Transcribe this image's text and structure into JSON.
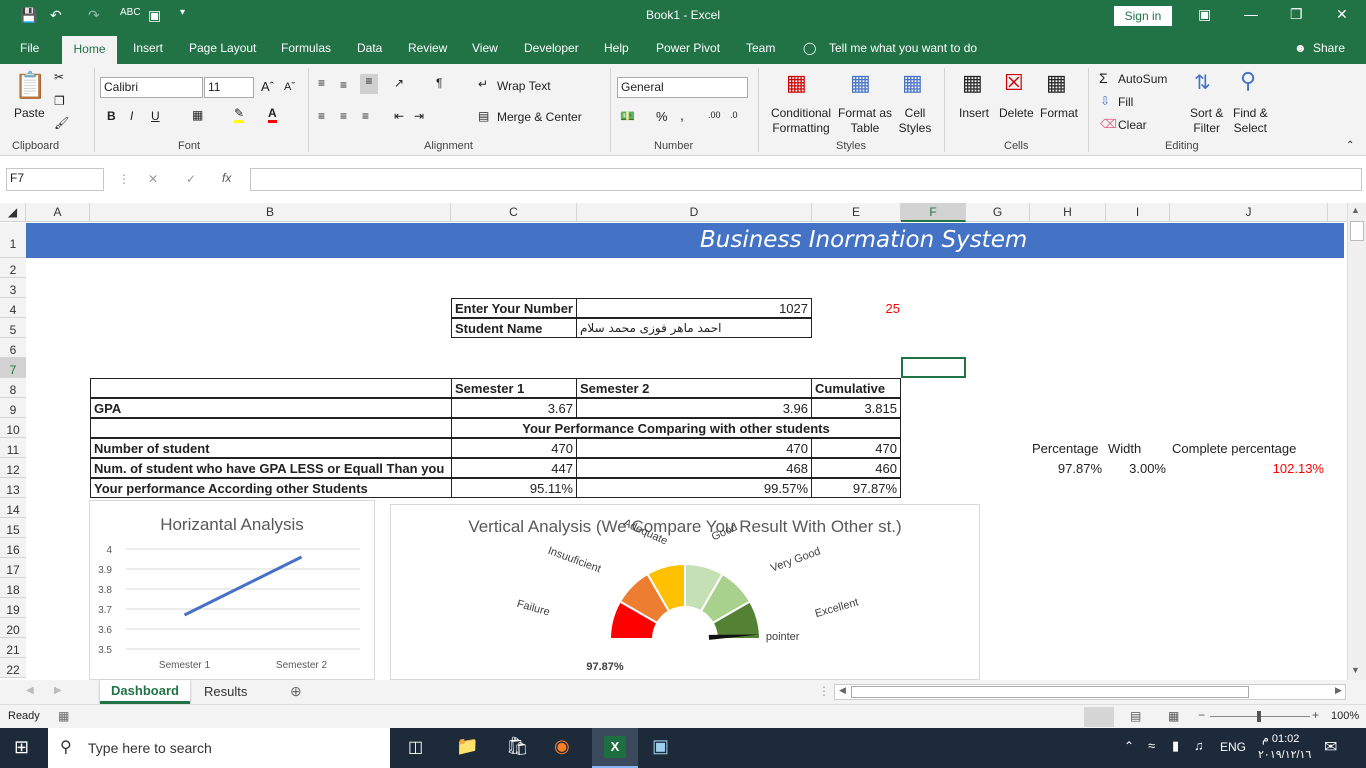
{
  "window": {
    "title": "Book1  -  Excel",
    "sign_in": "Sign in",
    "share": "Share"
  },
  "tabs": [
    "File",
    "Home",
    "Insert",
    "Page Layout",
    "Formulas",
    "Data",
    "Review",
    "View",
    "Developer",
    "Help",
    "Power Pivot",
    "Team"
  ],
  "tell_me": "Tell me what you want to do",
  "ribbon": {
    "paste": "Paste",
    "font_name": "Calibri",
    "font_size": "11",
    "wrap_text": "Wrap Text",
    "merge_center": "Merge & Center",
    "number_format": "General",
    "conditional": [
      "Conditional",
      "Formatting"
    ],
    "format_as": [
      "Format as",
      "Table"
    ],
    "cell_styles": [
      "Cell",
      "Styles"
    ],
    "insert": "Insert",
    "delete": "Delete",
    "format": "Format",
    "autosum": "AutoSum",
    "fill": "Fill",
    "clear": "Clear",
    "sort": [
      "Sort &",
      "Filter"
    ],
    "find": [
      "Find &",
      "Select"
    ],
    "groups": [
      "Clipboard",
      "Font",
      "Alignment",
      "Number",
      "Styles",
      "Cells",
      "Editing"
    ],
    "bold": "B",
    "italic": "I",
    "underline": "U",
    "percent": "%",
    "comma": ","
  },
  "formula_bar": {
    "name_box": "F7",
    "fx": "fx",
    "value": ""
  },
  "columns": [
    "A",
    "B",
    "C",
    "D",
    "E",
    "F",
    "G",
    "H",
    "I",
    "J"
  ],
  "rows": [
    "1",
    "2",
    "3",
    "4",
    "5",
    "6",
    "7",
    "8",
    "9",
    "10",
    "11",
    "12",
    "13",
    "14",
    "15",
    "16",
    "17",
    "18",
    "19",
    "20",
    "21",
    "22"
  ],
  "sheet": {
    "banner": "Business Inormation System",
    "enter_number_label": "Enter Your Number",
    "enter_number_value": "1027",
    "e4_value": "25",
    "student_name_label": "Student Name",
    "student_name_value": "احمد ماهر فوزى محمد سلام",
    "hdr_sem1": "Semester 1",
    "hdr_sem2": "Semester 2",
    "hdr_cum": "Cumulative",
    "gpa_label": "GPA",
    "gpa": [
      "3.67",
      "3.96",
      "3.815"
    ],
    "perf_header": "Your Performance Comparing with other students",
    "num_student_label": "Number of student",
    "num_student": [
      "470",
      "470",
      "470"
    ],
    "num_less_label": "Num. of student who have GPA LESS or Equall Than you",
    "num_less": [
      "447",
      "468",
      "460"
    ],
    "perf_label": "Your performance According other Students",
    "perf": [
      "95.11%",
      "99.57%",
      "97.87%"
    ],
    "pct_label": "Percentage",
    "width_label": "Width",
    "complete_label": "Complete percentage",
    "pct_value": "97.87%",
    "width_value": "3.00%",
    "complete_value": "102.13%"
  },
  "chart_data": [
    {
      "type": "line",
      "title": "Horizantal Analysis",
      "categories": [
        "Semester 1",
        "Semester 2"
      ],
      "values": [
        3.67,
        3.96
      ],
      "ylim": [
        3.5,
        4
      ],
      "yticks": [
        "4",
        "3.9",
        "3.8",
        "3.7",
        "3.6",
        "3.5"
      ],
      "grid": true,
      "color": "#4472c4"
    },
    {
      "type": "pie",
      "title": "Vertical Analysis (We Compare You Result With Other st.)",
      "categories": [
        "Failure",
        "Insuuficient",
        "Adequate",
        "Good",
        "Very Good",
        "Excellent"
      ],
      "values": [
        1,
        1,
        1,
        1,
        1,
        1
      ],
      "colors": [
        "#ff0000",
        "#ed7d31",
        "#ffc000",
        "#c5e0b4",
        "#a9d18e",
        "#548235"
      ],
      "pointer_label": "pointer",
      "pointer_value": 97.87,
      "value_label": "97.87%"
    }
  ],
  "sheet_tabs": [
    "Dashboard",
    "Results"
  ],
  "status": {
    "ready": "Ready",
    "zoom": "100%"
  },
  "taskbar": {
    "search": "Type here to search",
    "lang": "ENG",
    "time": "01:02 م",
    "date": "٢٠١٩/١٢/١٦"
  }
}
